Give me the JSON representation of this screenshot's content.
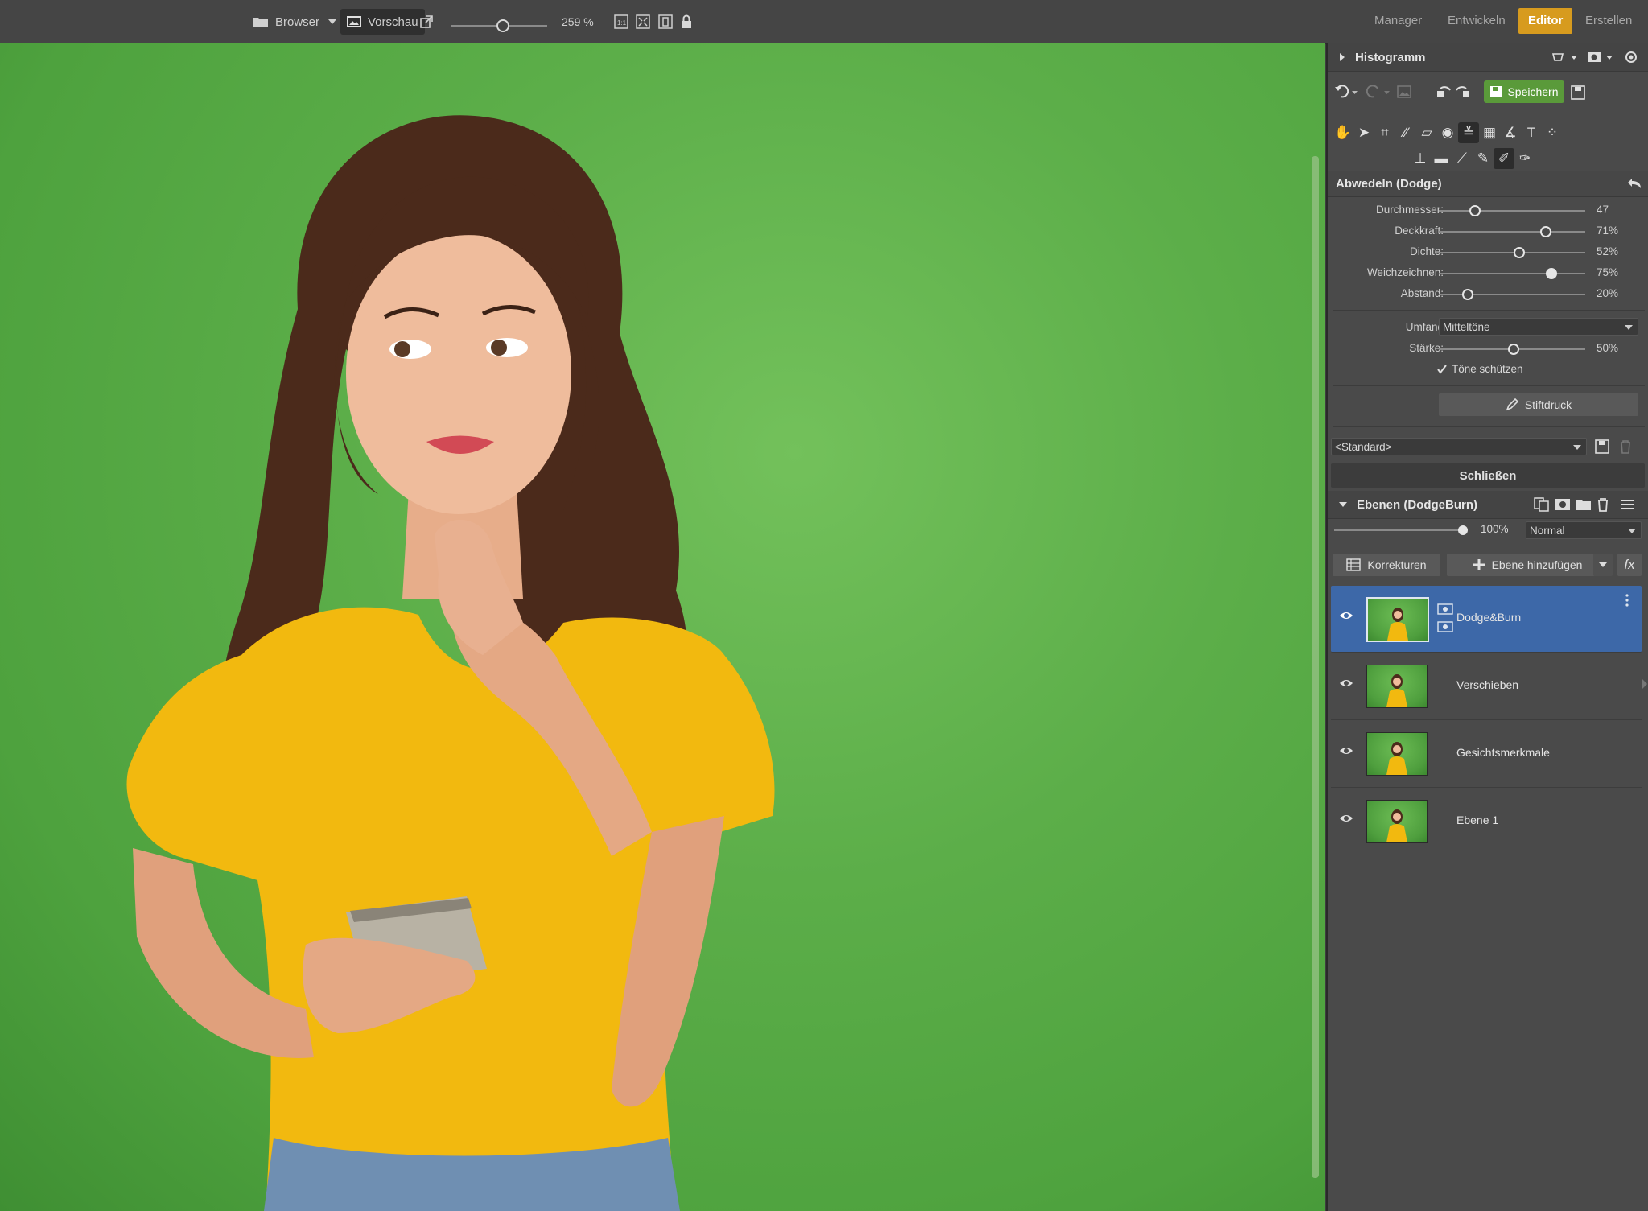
{
  "topbar": {
    "browser_label": "Browser",
    "vorschau_label": "Vorschau",
    "zoom_value": "259 %",
    "zoom_level_fraction": 0.5,
    "modes": [
      "Manager",
      "Entwickeln",
      "Editor",
      "Erstellen"
    ],
    "active_mode": "Editor",
    "accent_color": "#d79b1e"
  },
  "panel": {
    "histogram_title": "Histogramm",
    "save_label": "Speichern",
    "tool_title": "Abwedeln (Dodge)",
    "sliders": [
      {
        "label": "Durchmesser:",
        "value": "47",
        "level": 0.25
      },
      {
        "label": "Deckkraft:",
        "value": "71%",
        "level": 0.71
      },
      {
        "label": "Dichte:",
        "value": "52%",
        "level": 0.52
      },
      {
        "label": "Weichzeichnen:",
        "value": "75%",
        "level": 0.75
      },
      {
        "label": "Abstand:",
        "value": "20%",
        "level": 0.2
      }
    ],
    "umfang_label": "Umfang",
    "umfang_value": "Mitteltöne",
    "staerke": {
      "label": "Stärke:",
      "value": "50%",
      "level": 0.5
    },
    "toene_schuetzen": "Töne schützen",
    "toene_checked": true,
    "stiftdruck_label": "Stiftdruck",
    "preset_value": "<Standard>",
    "close_label": "Schließen"
  },
  "layers": {
    "title": "Ebenen (DodgeBurn)",
    "opacity_value": "100%",
    "opacity_level": 1.0,
    "blend_mode": "Normal",
    "korrekturen_label": "Korrekturen",
    "add_layer_label": "Ebene hinzufügen",
    "fx_label": "fx",
    "items": [
      {
        "name": "Dodge&Burn",
        "selected": true
      },
      {
        "name": "Verschieben",
        "selected": false
      },
      {
        "name": "Gesichtsmerkmale",
        "selected": false
      },
      {
        "name": "Ebene 1",
        "selected": false
      }
    ],
    "selected_color": "#3d68a8"
  }
}
